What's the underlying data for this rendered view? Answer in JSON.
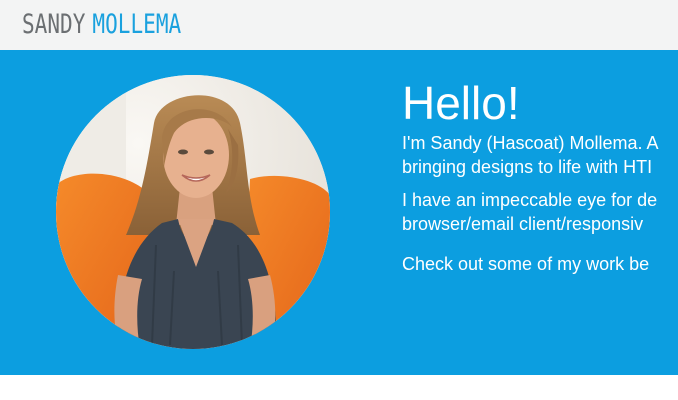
{
  "header": {
    "logo_first": "SANDY",
    "logo_last": "MOLLEMA"
  },
  "hero": {
    "title": "Hello!",
    "paragraph_1_line_1": "I'm Sandy (Hascoat) Mollema. A",
    "paragraph_1_line_2": "bringing designs to life with HTI",
    "paragraph_2_line_1": "I have an impeccable eye for de",
    "paragraph_2_line_2": "browser/email client/responsiv",
    "paragraph_3": "Check out some of my work be"
  },
  "colors": {
    "header_bg": "#f3f4f4",
    "logo_gray": "#6b6f72",
    "logo_blue": "#1aa1de",
    "hero_bg": "#0c9ee0",
    "text_white": "#ffffff"
  }
}
